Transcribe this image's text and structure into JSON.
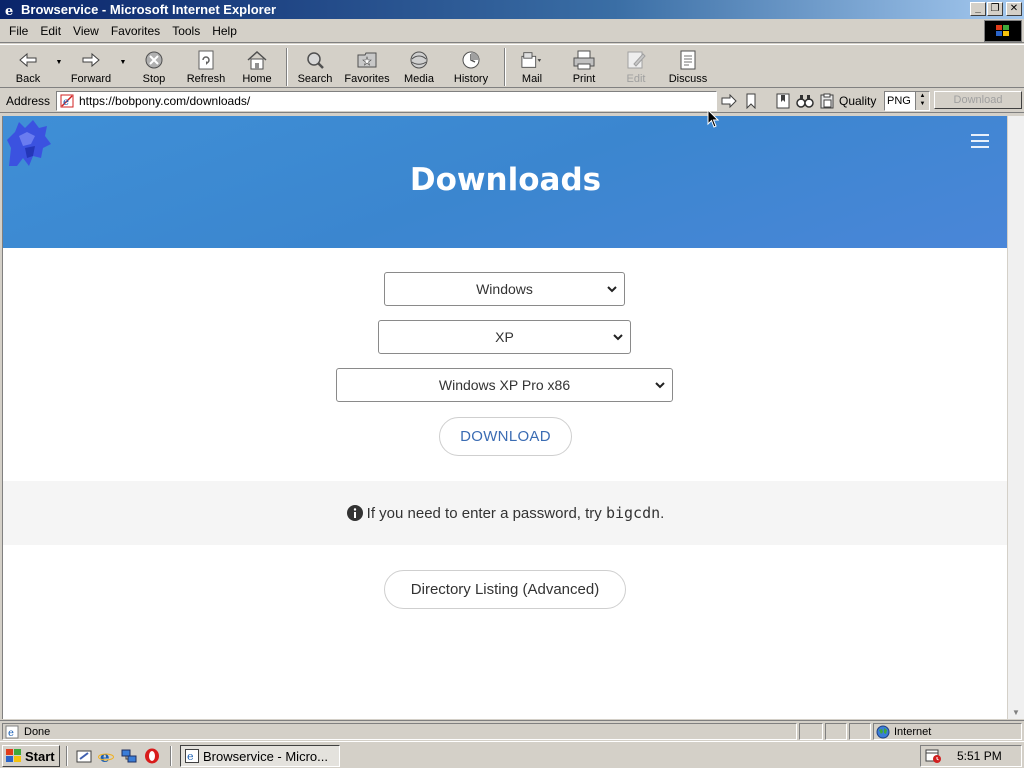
{
  "window": {
    "title": "Browservice - Microsoft Internet Explorer"
  },
  "menu": [
    "File",
    "Edit",
    "View",
    "Favorites",
    "Tools",
    "Help"
  ],
  "toolbar": {
    "buttons": [
      {
        "label": "Back",
        "icon": "back-arrow-icon"
      },
      {
        "label": "Forward",
        "icon": "forward-arrow-icon"
      },
      {
        "label": "Stop",
        "icon": "stop-icon"
      },
      {
        "label": "Refresh",
        "icon": "refresh-icon"
      },
      {
        "label": "Home",
        "icon": "home-icon"
      },
      {
        "label": "Search",
        "icon": "search-icon"
      },
      {
        "label": "Favorites",
        "icon": "favorites-icon"
      },
      {
        "label": "Media",
        "icon": "media-icon"
      },
      {
        "label": "History",
        "icon": "history-icon"
      },
      {
        "label": "Mail",
        "icon": "mail-icon"
      },
      {
        "label": "Print",
        "icon": "print-icon"
      },
      {
        "label": "Edit",
        "icon": "edit-icon",
        "disabled": true
      },
      {
        "label": "Discuss",
        "icon": "discuss-icon"
      }
    ]
  },
  "address": {
    "label": "Address",
    "url": "https://bobpony.com/downloads/",
    "quality_label": "Quality",
    "quality_value": "PNG",
    "download_label": "Download"
  },
  "page": {
    "title": "Downloads",
    "select_os": "Windows",
    "select_version": "XP",
    "select_edition": "Windows XP Pro x86",
    "download_button": "DOWNLOAD",
    "info_text": "If you need to enter a password, try",
    "info_password": "bigcdn",
    "info_period": ".",
    "directory_button": "Directory Listing (Advanced)",
    "accent_color": "#3b6cb3",
    "hero_color": "#3f8fd6"
  },
  "status": {
    "text": "Done",
    "zone": "Internet"
  },
  "taskbar": {
    "start_label": "Start",
    "task_label": "Browservice - Micro...",
    "clock": "5:51 PM"
  }
}
